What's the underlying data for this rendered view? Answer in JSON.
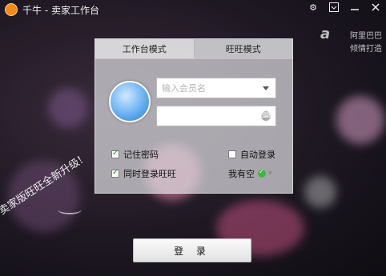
{
  "window": {
    "title": "千牛 - 卖家工作台",
    "controls": [
      "gear-icon",
      "menu-icon",
      "minimize-icon",
      "close-icon"
    ]
  },
  "brand": {
    "logo": "a",
    "line1": "阿里巴巴",
    "line2": "倾情打造"
  },
  "tabs": [
    {
      "label": "工作台模式",
      "active": true
    },
    {
      "label": "旺旺模式",
      "active": false
    }
  ],
  "login": {
    "username": {
      "value": "",
      "placeholder": "输入会员名"
    },
    "password": {
      "value": "",
      "placeholder": ""
    },
    "remember_password": {
      "label": "记住密码",
      "checked": true
    },
    "auto_login": {
      "label": "自动登录",
      "checked": false
    },
    "login_wangwang": {
      "label": "同时登录旺旺",
      "checked": true
    },
    "status": {
      "label": "我有空",
      "color": "#3db73d"
    },
    "submit_label": "登 录"
  },
  "slogan": "卖家版旺旺全新升级!"
}
